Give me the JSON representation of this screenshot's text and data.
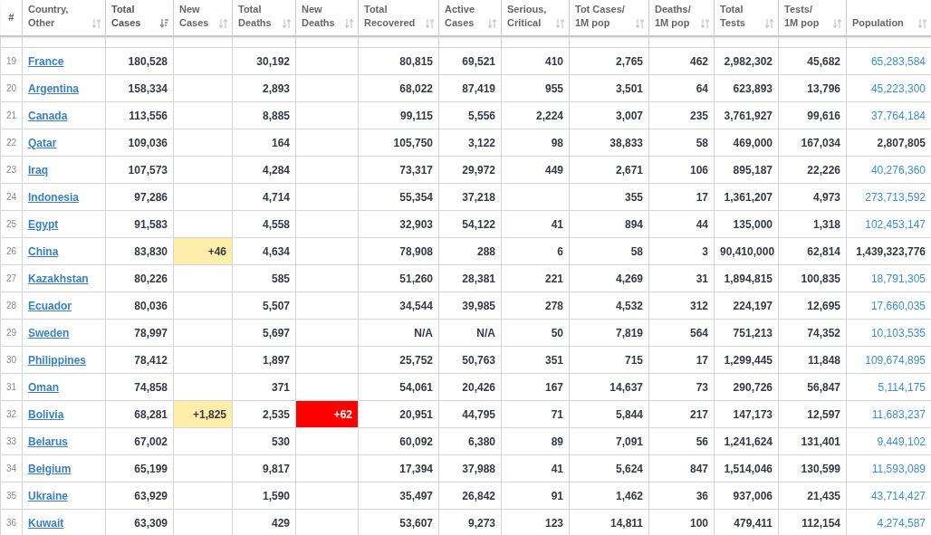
{
  "table": {
    "columns": [
      {
        "lines": [
          "#"
        ],
        "sortable": false,
        "sorted": false
      },
      {
        "lines": [
          "Country,",
          "Other"
        ],
        "sortable": true,
        "sorted": false
      },
      {
        "lines": [
          "Total",
          "Cases"
        ],
        "sortable": true,
        "sorted": true
      },
      {
        "lines": [
          "New",
          "Cases"
        ],
        "sortable": true,
        "sorted": false
      },
      {
        "lines": [
          "Total",
          "Deaths"
        ],
        "sortable": true,
        "sorted": false
      },
      {
        "lines": [
          "New",
          "Deaths"
        ],
        "sortable": true,
        "sorted": false
      },
      {
        "lines": [
          "Total",
          "Recovered"
        ],
        "sortable": true,
        "sorted": false
      },
      {
        "lines": [
          "Active",
          "Cases"
        ],
        "sortable": true,
        "sorted": false
      },
      {
        "lines": [
          "Serious,",
          "Critical"
        ],
        "sortable": true,
        "sorted": false
      },
      {
        "lines": [
          "Tot Cases/",
          "1M pop"
        ],
        "sortable": true,
        "sorted": false
      },
      {
        "lines": [
          "Deaths/",
          "1M pop"
        ],
        "sortable": true,
        "sorted": false
      },
      {
        "lines": [
          "Total",
          "Tests"
        ],
        "sortable": true,
        "sorted": false
      },
      {
        "lines": [
          "Tests/",
          "1M pop"
        ],
        "sortable": true,
        "sorted": false
      },
      {
        "lines": [
          "Population"
        ],
        "sortable": true,
        "sorted": false
      }
    ],
    "rows": [
      {
        "rank": "19",
        "country": "France",
        "total_cases": "180,528",
        "total_deaths": "30,192",
        "total_recovered": "80,815",
        "active_cases": "69,521",
        "serious_critical": "410",
        "cases_per_1m": "2,765",
        "deaths_per_1m": "462",
        "total_tests": "2,982,302",
        "tests_per_1m": "45,682",
        "population": "65,283,584",
        "population_linked": true
      },
      {
        "rank": "20",
        "country": "Argentina",
        "total_cases": "158,334",
        "total_deaths": "2,893",
        "total_recovered": "68,022",
        "active_cases": "87,419",
        "serious_critical": "955",
        "cases_per_1m": "3,501",
        "deaths_per_1m": "64",
        "total_tests": "623,893",
        "tests_per_1m": "13,796",
        "population": "45,223,300",
        "population_linked": true
      },
      {
        "rank": "21",
        "country": "Canada",
        "total_cases": "113,556",
        "total_deaths": "8,885",
        "total_recovered": "99,115",
        "active_cases": "5,556",
        "serious_critical": "2,224",
        "cases_per_1m": "3,007",
        "deaths_per_1m": "235",
        "total_tests": "3,761,927",
        "tests_per_1m": "99,616",
        "population": "37,764,184",
        "population_linked": true
      },
      {
        "rank": "22",
        "country": "Qatar",
        "total_cases": "109,036",
        "total_deaths": "164",
        "total_recovered": "105,750",
        "active_cases": "3,122",
        "serious_critical": "98",
        "cases_per_1m": "38,833",
        "deaths_per_1m": "58",
        "total_tests": "469,000",
        "tests_per_1m": "167,034",
        "population": "2,807,805",
        "population_linked": false
      },
      {
        "rank": "23",
        "country": "Iraq",
        "total_cases": "107,573",
        "total_deaths": "4,284",
        "total_recovered": "73,317",
        "active_cases": "29,972",
        "serious_critical": "449",
        "cases_per_1m": "2,671",
        "deaths_per_1m": "106",
        "total_tests": "895,187",
        "tests_per_1m": "22,226",
        "population": "40,276,360",
        "population_linked": true
      },
      {
        "rank": "24",
        "country": "Indonesia",
        "total_cases": "97,286",
        "total_deaths": "4,714",
        "total_recovered": "55,354",
        "active_cases": "37,218",
        "cases_per_1m": "355",
        "deaths_per_1m": "17",
        "total_tests": "1,361,207",
        "tests_per_1m": "4,973",
        "population": "273,713,592",
        "population_linked": true
      },
      {
        "rank": "25",
        "country": "Egypt",
        "total_cases": "91,583",
        "total_deaths": "4,558",
        "total_recovered": "32,903",
        "active_cases": "54,122",
        "serious_critical": "41",
        "cases_per_1m": "894",
        "deaths_per_1m": "44",
        "total_tests": "135,000",
        "tests_per_1m": "1,318",
        "population": "102,453,147",
        "population_linked": true
      },
      {
        "rank": "26",
        "country": "China",
        "total_cases": "83,830",
        "new_cases": "+46",
        "total_deaths": "4,634",
        "total_recovered": "78,908",
        "active_cases": "288",
        "serious_critical": "6",
        "cases_per_1m": "58",
        "deaths_per_1m": "3",
        "total_tests": "90,410,000",
        "tests_per_1m": "62,814",
        "population": "1,439,323,776",
        "population_linked": false
      },
      {
        "rank": "27",
        "country": "Kazakhstan",
        "total_cases": "80,226",
        "total_deaths": "585",
        "total_recovered": "51,260",
        "active_cases": "28,381",
        "serious_critical": "221",
        "cases_per_1m": "4,269",
        "deaths_per_1m": "31",
        "total_tests": "1,894,815",
        "tests_per_1m": "100,835",
        "population": "18,791,305",
        "population_linked": true
      },
      {
        "rank": "28",
        "country": "Ecuador",
        "total_cases": "80,036",
        "total_deaths": "5,507",
        "total_recovered": "34,544",
        "active_cases": "39,985",
        "serious_critical": "278",
        "cases_per_1m": "4,532",
        "deaths_per_1m": "312",
        "total_tests": "224,197",
        "tests_per_1m": "12,695",
        "population": "17,660,035",
        "population_linked": true
      },
      {
        "rank": "29",
        "country": "Sweden",
        "total_cases": "78,997",
        "total_deaths": "5,697",
        "total_recovered": "N/A",
        "active_cases": "N/A",
        "serious_critical": "50",
        "cases_per_1m": "7,819",
        "deaths_per_1m": "564",
        "total_tests": "751,213",
        "tests_per_1m": "74,352",
        "population": "10,103,535",
        "population_linked": true
      },
      {
        "rank": "30",
        "country": "Philippines",
        "total_cases": "78,412",
        "total_deaths": "1,897",
        "total_recovered": "25,752",
        "active_cases": "50,763",
        "serious_critical": "351",
        "cases_per_1m": "715",
        "deaths_per_1m": "17",
        "total_tests": "1,299,445",
        "tests_per_1m": "11,848",
        "population": "109,674,895",
        "population_linked": true
      },
      {
        "rank": "31",
        "country": "Oman",
        "total_cases": "74,858",
        "total_deaths": "371",
        "total_recovered": "54,061",
        "active_cases": "20,426",
        "serious_critical": "167",
        "cases_per_1m": "14,637",
        "deaths_per_1m": "73",
        "total_tests": "290,726",
        "tests_per_1m": "56,847",
        "population": "5,114,175",
        "population_linked": true
      },
      {
        "rank": "32",
        "country": "Bolivia",
        "total_cases": "68,281",
        "new_cases": "+1,825",
        "total_deaths": "2,535",
        "new_deaths": "+62",
        "total_recovered": "20,951",
        "active_cases": "44,795",
        "serious_critical": "71",
        "cases_per_1m": "5,844",
        "deaths_per_1m": "217",
        "total_tests": "147,173",
        "tests_per_1m": "12,597",
        "population": "11,683,237",
        "population_linked": true
      },
      {
        "rank": "33",
        "country": "Belarus",
        "total_cases": "67,002",
        "total_deaths": "530",
        "total_recovered": "60,092",
        "active_cases": "6,380",
        "serious_critical": "89",
        "cases_per_1m": "7,091",
        "deaths_per_1m": "56",
        "total_tests": "1,241,624",
        "tests_per_1m": "131,401",
        "population": "9,449,102",
        "population_linked": true
      },
      {
        "rank": "34",
        "country": "Belgium",
        "total_cases": "65,199",
        "total_deaths": "9,817",
        "total_recovered": "17,394",
        "active_cases": "37,988",
        "serious_critical": "41",
        "cases_per_1m": "5,624",
        "deaths_per_1m": "847",
        "total_tests": "1,514,046",
        "tests_per_1m": "130,599",
        "population": "11,593,089",
        "population_linked": true
      },
      {
        "rank": "35",
        "country": "Ukraine",
        "total_cases": "63,929",
        "total_deaths": "1,590",
        "total_recovered": "35,497",
        "active_cases": "26,842",
        "serious_critical": "91",
        "cases_per_1m": "1,462",
        "deaths_per_1m": "36",
        "total_tests": "937,006",
        "tests_per_1m": "21,435",
        "population": "43,714,427",
        "population_linked": true
      },
      {
        "rank": "36",
        "country": "Kuwait",
        "total_cases": "63,309",
        "total_deaths": "429",
        "total_recovered": "53,607",
        "active_cases": "9,273",
        "serious_critical": "123",
        "cases_per_1m": "14,811",
        "deaths_per_1m": "100",
        "total_tests": "479,411",
        "tests_per_1m": "112,154",
        "population": "4,274,587",
        "population_linked": true
      }
    ]
  }
}
